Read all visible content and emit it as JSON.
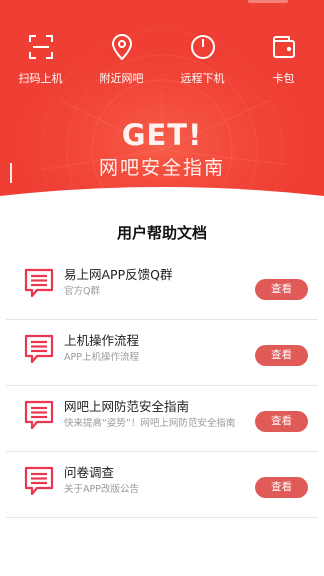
{
  "colors": {
    "brand_red": "#ef3e34",
    "button_red": "#e05a58",
    "icon_pink": "#e8374f"
  },
  "quick_actions": [
    {
      "label": "扫码上机",
      "icon": "scan-icon"
    },
    {
      "label": "附近网吧",
      "icon": "location-pin-icon"
    },
    {
      "label": "远程下机",
      "icon": "power-icon"
    },
    {
      "label": "卡包",
      "icon": "wallet-icon"
    }
  ],
  "banner": {
    "title": "GET!",
    "subtitle": "网吧安全指南"
  },
  "help_section": {
    "title": "用户帮助文档",
    "items": [
      {
        "title": "易上网APP反馈Q群",
        "desc": "官方Q群",
        "button": "查看",
        "icon": "document-chat-icon"
      },
      {
        "title": "上机操作流程",
        "desc": "APP上机操作流程",
        "button": "查看",
        "icon": "document-chat-icon"
      },
      {
        "title": "网吧上网防范安全指南",
        "desc": "快来提高“姿势”！网吧上网防范安全指南",
        "button": "查看",
        "icon": "document-chat-icon"
      },
      {
        "title": "问卷调查",
        "desc": "关于APP改版公告",
        "button": "查看",
        "icon": "document-chat-icon"
      }
    ]
  }
}
